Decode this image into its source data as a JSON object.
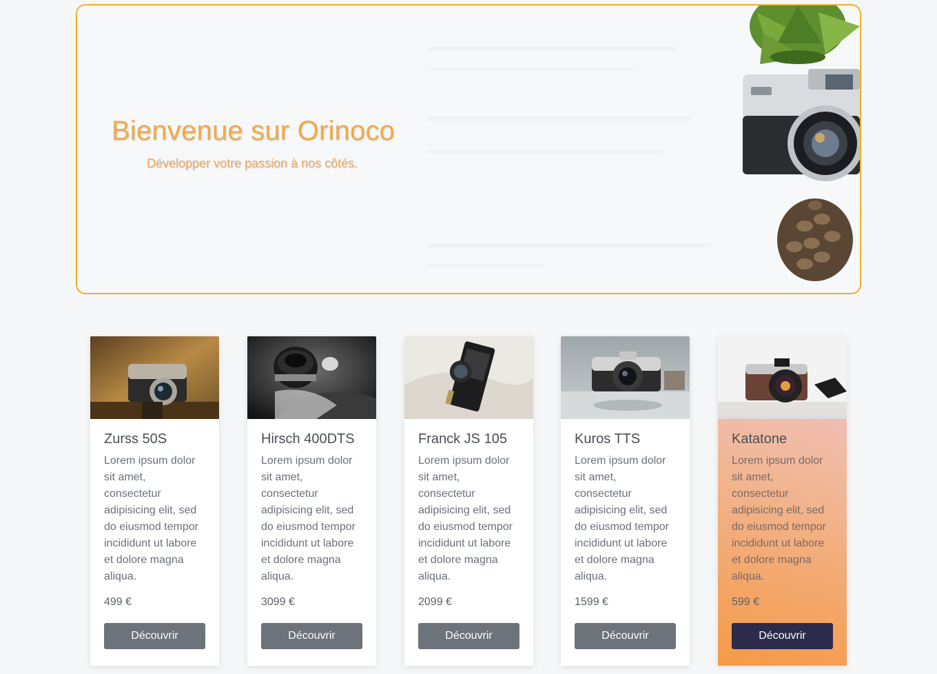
{
  "hero": {
    "title": "Bienvenue sur Orinoco",
    "subtitle": "Développer votre passion à nos côtés."
  },
  "colors": {
    "accent": "#f2ad2a",
    "button": "#6c737b",
    "button_featured": "#2d2a4a"
  },
  "products": [
    {
      "name": "Zurss 50S",
      "description": "Lorem ipsum dolor sit amet, consectetur adipisicing elit, sed do eiusmod tempor incididunt ut labore et dolore magna aliqua.",
      "price": "499 €",
      "button": "Découvrir"
    },
    {
      "name": "Hirsch 400DTS",
      "description": "Lorem ipsum dolor sit amet, consectetur adipisicing elit, sed do eiusmod tempor incididunt ut labore et dolore magna aliqua.",
      "price": "3099 €",
      "button": "Découvrir"
    },
    {
      "name": "Franck JS 105",
      "description": "Lorem ipsum dolor sit amet, consectetur adipisicing elit, sed do eiusmod tempor incididunt ut labore et dolore magna aliqua.",
      "price": "2099 €",
      "button": "Découvrir"
    },
    {
      "name": "Kuros TTS",
      "description": "Lorem ipsum dolor sit amet, consectetur adipisicing elit, sed do eiusmod tempor incididunt ut labore et dolore magna aliqua.",
      "price": "1599 €",
      "button": "Découvrir"
    },
    {
      "name": "Katatone",
      "description": "Lorem ipsum dolor sit amet, consectetur adipisicing elit, sed do eiusmod tempor incididunt ut labore et dolore magna aliqua.",
      "price": "599 €",
      "button": "Découvrir"
    }
  ]
}
